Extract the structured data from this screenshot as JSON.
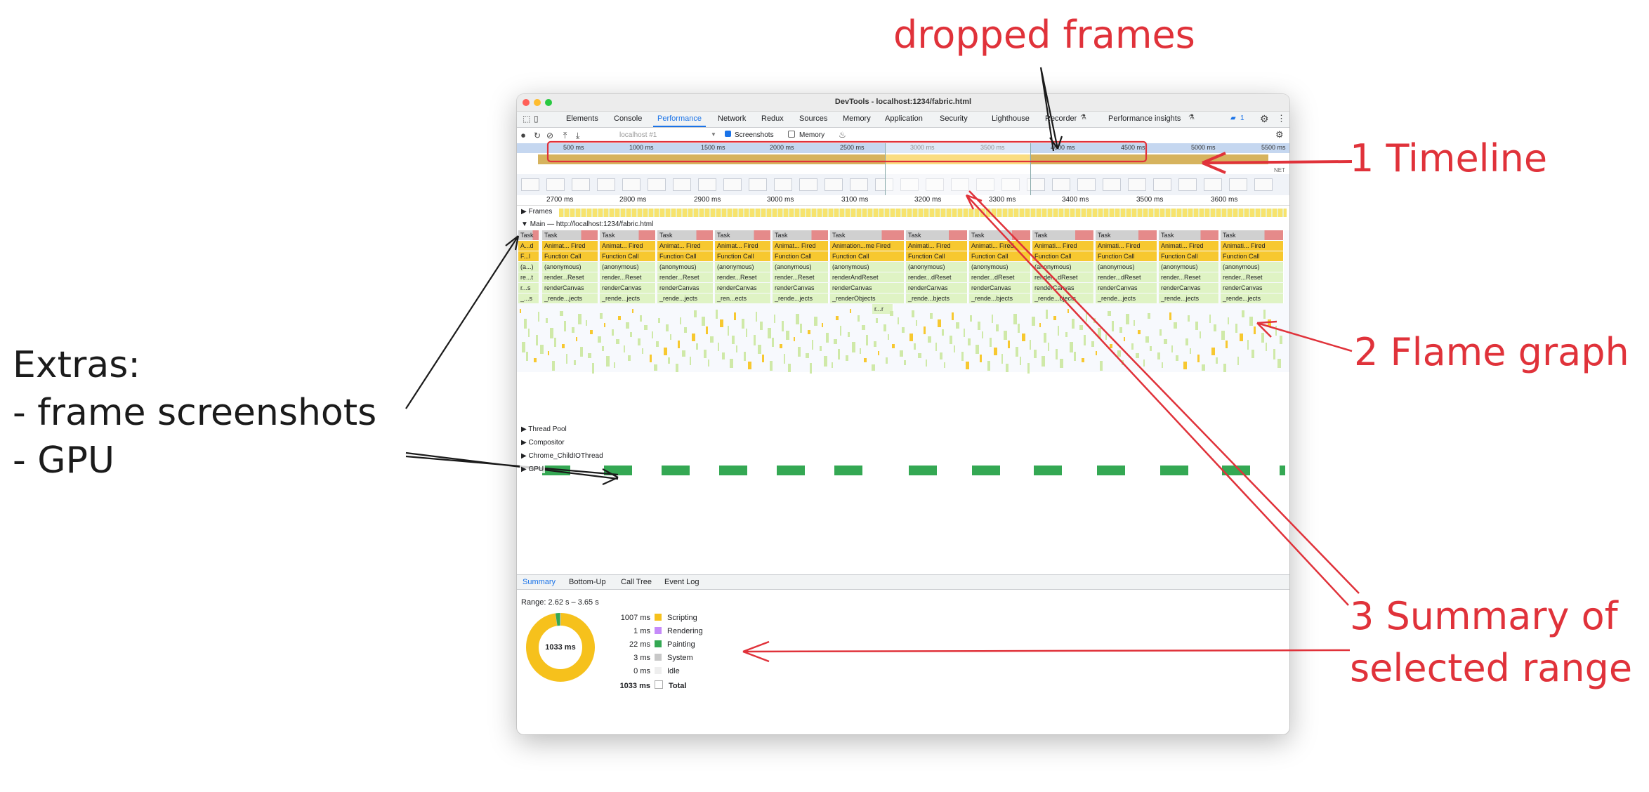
{
  "annotations": {
    "dropped_frames": "dropped frames",
    "timeline": "1 Timeline",
    "flame_graph": "2 Flame graph",
    "summary_line1": "3 Summary of",
    "summary_line2": "selected range",
    "extras_title": "Extras:",
    "extras_item1": "- frame screenshots",
    "extras_item2": "- GPU"
  },
  "colors": {
    "annotation_red": "#e0323a",
    "accent": "#1a73e8",
    "scripting": "#f6c11c",
    "rendering": "#c58af9",
    "painting": "#34a853",
    "system": "#c8c8c8",
    "idle": "#eeeeee"
  },
  "window": {
    "title": "DevTools - localhost:1234/fabric.html"
  },
  "tabs": [
    "Elements",
    "Console",
    "Performance",
    "Network",
    "Redux",
    "Sources",
    "Memory",
    "Application",
    "Security",
    "Lighthouse",
    "Recorder",
    "Performance insights"
  ],
  "active_tab": "Performance",
  "issues_badge": "1",
  "toolbar": {
    "target": "localhost #1",
    "screenshots_label": "Screenshots",
    "memory_label": "Memory"
  },
  "overview_ruler": [
    "500 ms",
    "1000 ms",
    "1500 ms",
    "2000 ms",
    "2500 ms",
    "3000 ms",
    "3500 ms",
    "4000 ms",
    "4500 ms",
    "5000 ms",
    "5500 ms"
  ],
  "net_label": "NET",
  "detail_ticks": [
    "2700 ms",
    "2800 ms",
    "2900 ms",
    "3000 ms",
    "3100 ms",
    "3200 ms",
    "3300 ms",
    "3400 ms",
    "3500 ms",
    "3600 ms"
  ],
  "tracks": {
    "frames": "Frames",
    "main": "Main — http://localhost:1234/fabric.html",
    "thread_pool": "Thread Pool",
    "compositor": "Compositor",
    "child_io": "Chrome_ChildIOThread",
    "gpu": "GPU"
  },
  "flame_columns": [
    {
      "task": "Task",
      "anim": "A...d",
      "fn": "F...l",
      "anon": "(a...)",
      "render": "re...t",
      "canvas": "r...s",
      "objects": "_...s"
    },
    {
      "task": "Task",
      "anim": "Animat... Fired",
      "fn": "Function Call",
      "anon": "(anonymous)",
      "render": "render...Reset",
      "canvas": "renderCanvas",
      "objects": "_rende...jects"
    },
    {
      "task": "Task",
      "anim": "Animat... Fired",
      "fn": "Function Call",
      "anon": "(anonymous)",
      "render": "render...Reset",
      "canvas": "renderCanvas",
      "objects": "_rende...jects"
    },
    {
      "task": "Task",
      "anim": "Animat... Fired",
      "fn": "Function Call",
      "anon": "(anonymous)",
      "render": "render...Reset",
      "canvas": "renderCanvas",
      "objects": "_rende...jects"
    },
    {
      "task": "Task",
      "anim": "Animat... Fired",
      "fn": "Function Call",
      "anon": "(anonymous)",
      "render": "render...Reset",
      "canvas": "renderCanvas",
      "objects": "_ren...ects"
    },
    {
      "task": "Task",
      "anim": "Animat... Fired",
      "fn": "Function Call",
      "anon": "(anonymous)",
      "render": "render...Reset",
      "canvas": "renderCanvas",
      "objects": "_rende...jects"
    },
    {
      "task": "Task",
      "anim": "Animation...me Fired",
      "fn": "Function Call",
      "anon": "(anonymous)",
      "render": "renderAndReset",
      "canvas": "renderCanvas",
      "objects": "_renderObjects",
      "extra": "r...r"
    },
    {
      "task": "Task",
      "anim": "Animati... Fired",
      "fn": "Function Call",
      "anon": "(anonymous)",
      "render": "render...dReset",
      "canvas": "renderCanvas",
      "objects": "_rende...bjects"
    },
    {
      "task": "Task",
      "anim": "Animati... Fired",
      "fn": "Function Call",
      "anon": "(anonymous)",
      "render": "render...dReset",
      "canvas": "renderCanvas",
      "objects": "_rende...bjects"
    },
    {
      "task": "Task",
      "anim": "Animati... Fired",
      "fn": "Function Call",
      "anon": "(anonymous)",
      "render": "render...dReset",
      "canvas": "renderCanvas",
      "objects": "_rende...bjects"
    },
    {
      "task": "Task",
      "anim": "Animati... Fired",
      "fn": "Function Call",
      "anon": "(anonymous)",
      "render": "render...dReset",
      "canvas": "renderCanvas",
      "objects": "_rende...jects"
    },
    {
      "task": "Task",
      "anim": "Animati... Fired",
      "fn": "Function Call",
      "anon": "(anonymous)",
      "render": "render...Reset",
      "canvas": "renderCanvas",
      "objects": "_rende...jects"
    },
    {
      "task": "Task",
      "anim": "Animati... Fired",
      "fn": "Function Call",
      "anon": "(anonymous)",
      "render": "render...Reset",
      "canvas": "renderCanvas",
      "objects": "_rende...jects"
    }
  ],
  "bottom_tabs": [
    "Summary",
    "Bottom-Up",
    "Call Tree",
    "Event Log"
  ],
  "summary": {
    "range": "Range: 2.62 s – 3.65 s",
    "total_center": "1033 ms",
    "rows": [
      {
        "value": "1007 ms",
        "label": "Scripting",
        "color": "#f6c11c"
      },
      {
        "value": "1 ms",
        "label": "Rendering",
        "color": "#c58af9"
      },
      {
        "value": "22 ms",
        "label": "Painting",
        "color": "#34a853"
      },
      {
        "value": "3 ms",
        "label": "System",
        "color": "#c8c8c8"
      },
      {
        "value": "0 ms",
        "label": "Idle",
        "color": "#eeeeee"
      },
      {
        "value": "1033 ms",
        "label": "Total",
        "color": "#ffffff"
      }
    ],
    "donut": {
      "scripting_ms": 1007,
      "rendering_ms": 1,
      "painting_ms": 22,
      "system_ms": 3,
      "idle_ms": 0
    }
  }
}
